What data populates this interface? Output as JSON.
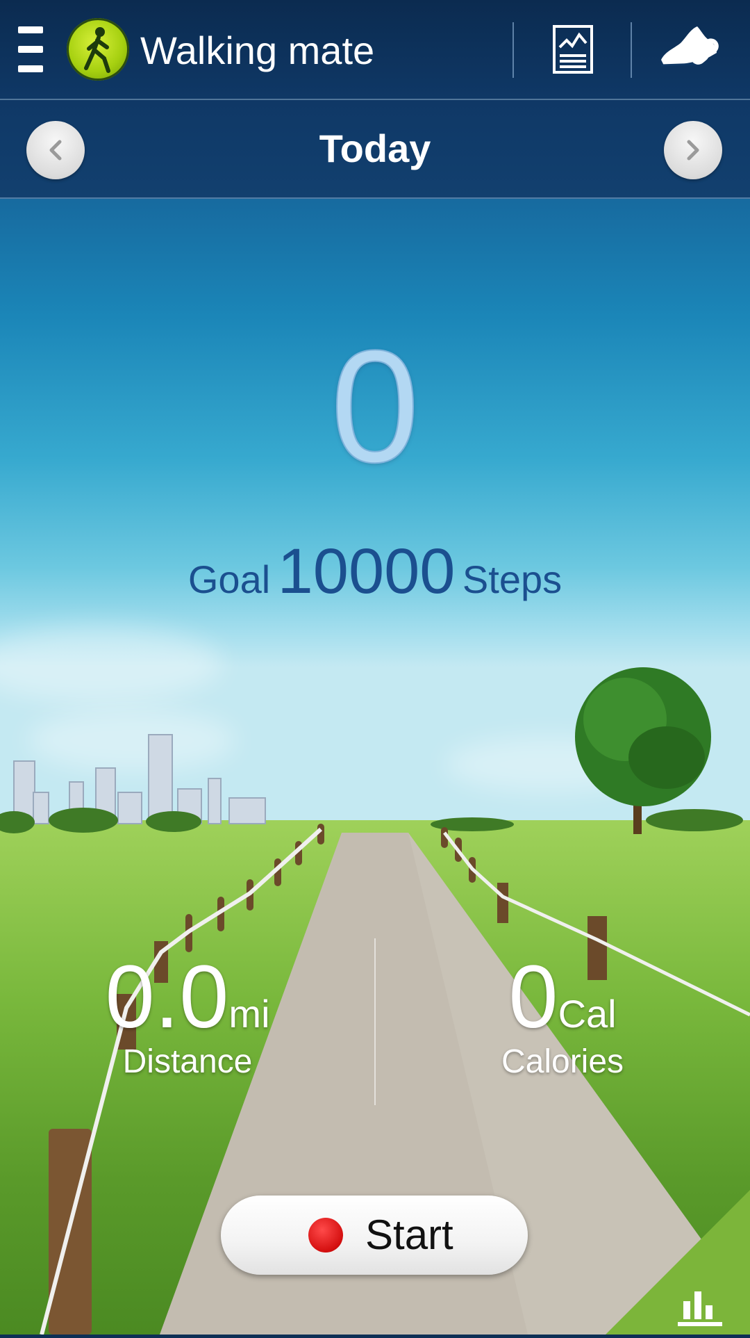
{
  "header": {
    "title": "Walking mate",
    "icons": {
      "menu": "menu-icon",
      "logo": "walking-person-icon",
      "report": "report-chart-icon",
      "shoe": "shoe-link-icon"
    }
  },
  "datebar": {
    "label": "Today",
    "prev_icon": "chevron-left-icon",
    "next_icon": "chevron-right-icon"
  },
  "steps": {
    "count": "0",
    "goal_prefix": "Goal",
    "goal_value": "10000",
    "goal_suffix": "Steps"
  },
  "stats": {
    "distance": {
      "value": "0.0",
      "unit": "mi",
      "label": "Distance"
    },
    "calories": {
      "value": "0",
      "unit": "Cal",
      "label": "Calories"
    }
  },
  "start_button": {
    "label": "Start"
  },
  "corner_button": {
    "icon": "bar-chart-icon"
  },
  "colors": {
    "header": "#0f3866",
    "accent_green": "#7cb53a",
    "record_red": "#d40f0f",
    "goal_text": "#1b4f8f"
  }
}
